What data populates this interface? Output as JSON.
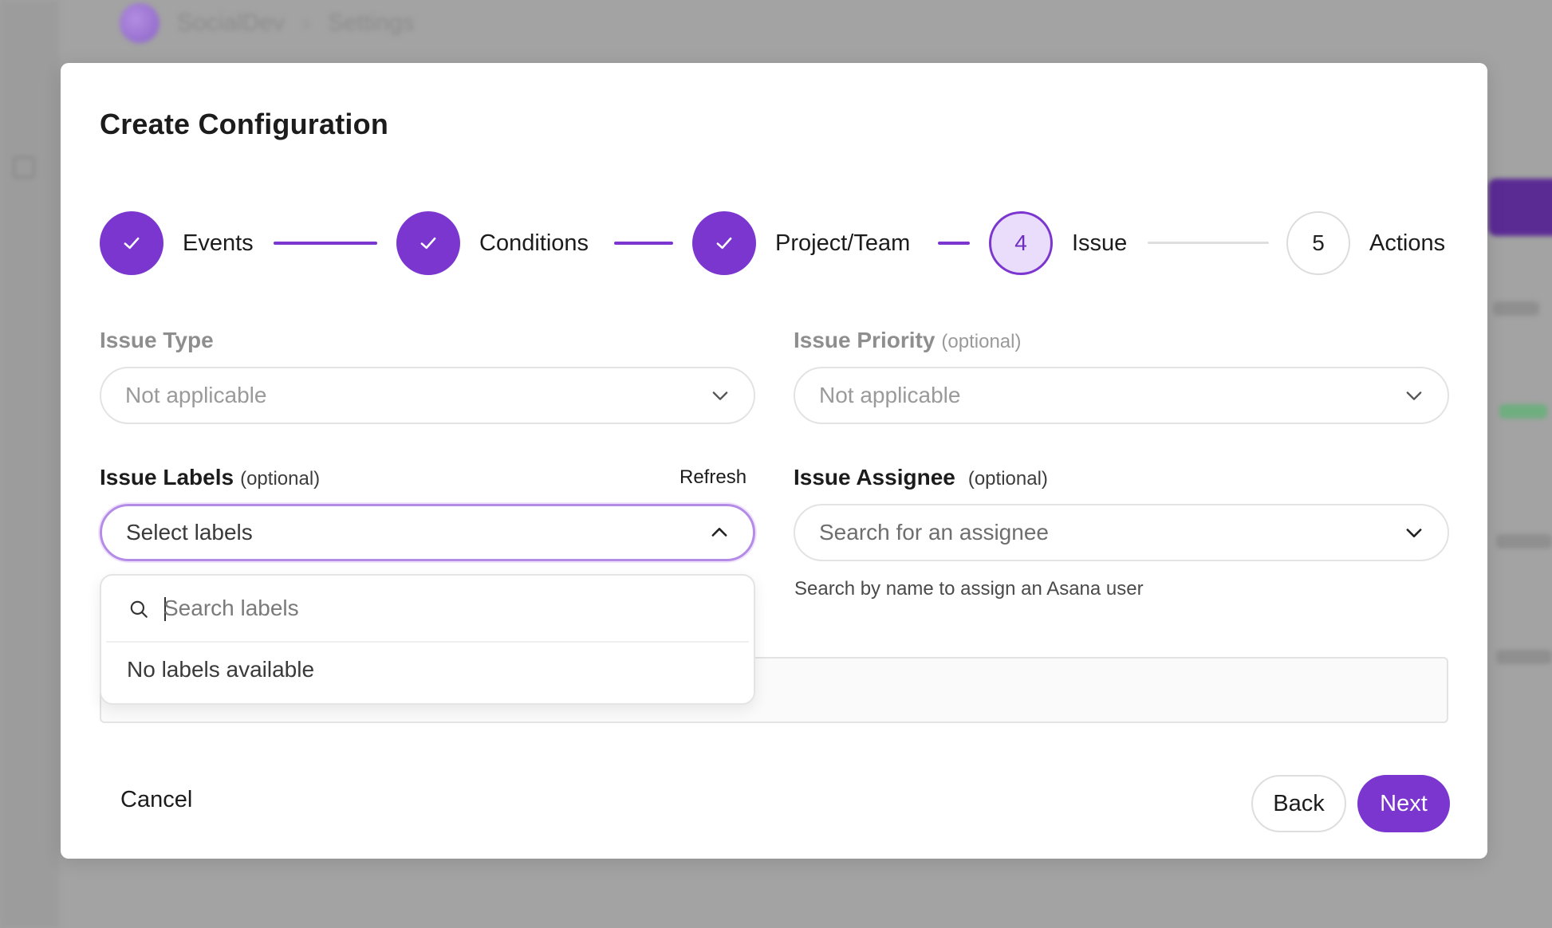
{
  "background": {
    "breadcrumb": [
      "SocialDev",
      "›",
      "Settings"
    ]
  },
  "modal": {
    "title": "Create Configuration",
    "steps": [
      {
        "label": "Events",
        "state": "done",
        "icon": "check-icon"
      },
      {
        "label": "Conditions",
        "state": "done",
        "icon": "check-icon"
      },
      {
        "label": "Project/Team",
        "state": "done",
        "icon": "check-icon"
      },
      {
        "label": "Issue",
        "number": "4",
        "state": "current"
      },
      {
        "label": "Actions",
        "number": "5",
        "state": "pending"
      }
    ],
    "issue_type": {
      "label": "Issue Type",
      "value": "Not applicable"
    },
    "issue_priority": {
      "label": "Issue Priority",
      "optional": "(optional)",
      "value": "Not applicable"
    },
    "issue_labels": {
      "label": "Issue Labels",
      "optional": "(optional)",
      "refresh": "Refresh",
      "placeholder": "Select labels",
      "dropdown": {
        "search_placeholder": "Search labels",
        "empty_text": "No labels available"
      }
    },
    "issue_assignee": {
      "label": "Issue Assignee",
      "optional": "(optional)",
      "placeholder": "Search for an assignee",
      "helper": "Search by name to assign an Asana user"
    },
    "footer": {
      "cancel": "Cancel",
      "back": "Back",
      "next": "Next"
    }
  },
  "colors": {
    "accent": "#7b36cf",
    "accent_light": "#e9ddfb",
    "overlay": "#a3a3a3"
  }
}
